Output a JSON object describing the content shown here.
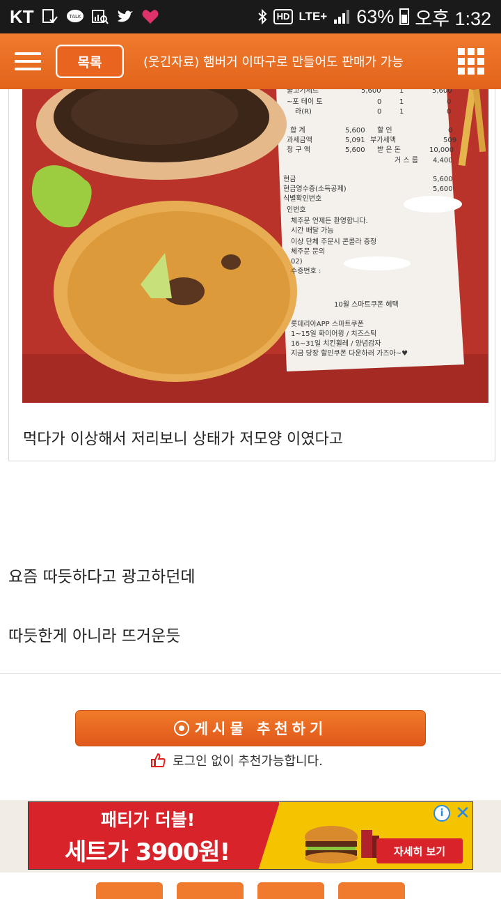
{
  "status_bar": {
    "carrier": "KT",
    "network": "LTE+",
    "hd": "HD",
    "battery": "63%",
    "time": "오후 1:32"
  },
  "header": {
    "list_button": "목록",
    "title": "(웃긴자료) 햄버거 이따구로 만들어도 판매가 가능"
  },
  "post": {
    "caption": "먹다가 이상해서 저리보니 상태가 저모양 이였다고",
    "lines": [
      "요즘 따듯하다고 광고하던데",
      "따듯한게 아니라 뜨거운듯"
    ],
    "receipt": {
      "rows": [
        [
          "불고기세트",
          "5,600",
          "1",
          "5,600"
        ],
        [
          "~포 테이 토",
          "0",
          "1",
          "0"
        ],
        [
          "라(R)",
          "0",
          "1",
          "0"
        ]
      ],
      "total_label": "합 계",
      "total": "5,600",
      "discount_label": "할 인",
      "discount": "0",
      "taxable_label": "과세금액",
      "taxable": "5,091",
      "vat_label": "부가세액",
      "vat": "509",
      "charge_label": "청 구 액",
      "charge": "5,600",
      "received_label": "받 은 돈",
      "received": "10,000",
      "change_label": "거 스 름",
      "change": "4,400",
      "cash_label": "현금",
      "cash": "5,600",
      "receipt_label": "현금영수증(소득공제)",
      "receipt_amount": "5,600",
      "id_label": "식별확인번호",
      "approval_label": "인번호",
      "notes": [
        "체주문 언제든 환영합니다.",
        "시간 배달 가능",
        "이상 단체 주문시 콘콜라 증정",
        "체주문 문의",
        "02)",
        "수증번호 :"
      ],
      "promo_title": "10월 스마트쿠폰 혜택",
      "promo_lines": [
        "롯데리아APP 스마트쿠폰",
        "1~15일 화이어윙 / 치즈스틱",
        "16~31일 치킨휠레 / 양념감자",
        "지금 당장 할인쿠폰 다운하러 가즈아~♥"
      ]
    }
  },
  "recommend": {
    "button": "게시물 추천하기",
    "note": "로그인 없이 추천가능합니다."
  },
  "ad": {
    "headline_1": "패티가 더블!",
    "headline_2": "세트가 3900원!",
    "detail_button": "자세히 보기",
    "info": "i",
    "close": "✕",
    "colors": {
      "left": "#d8232a",
      "right": "#f5c400"
    }
  },
  "colors": {
    "accent": "#e8641f"
  }
}
